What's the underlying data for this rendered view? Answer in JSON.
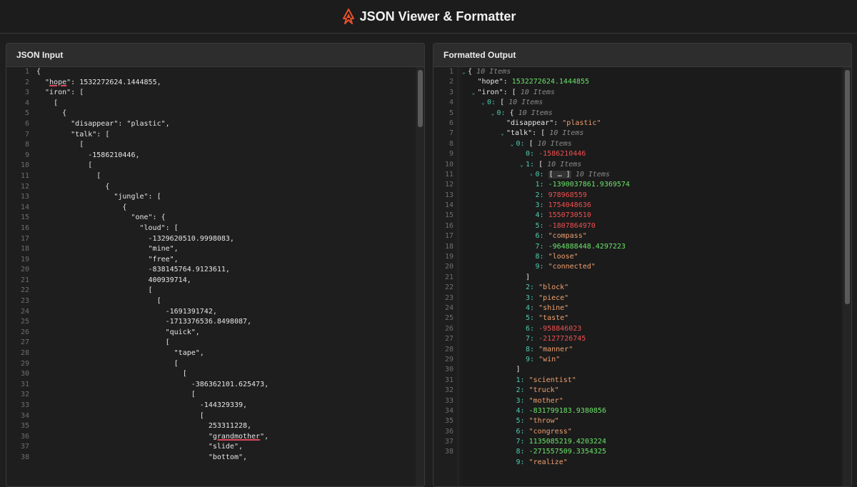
{
  "header": {
    "title": "JSON Viewer & Formatter",
    "logo_icon": "flame-logo-icon"
  },
  "input_panel": {
    "title": "JSON Input",
    "line_numbers": [
      "1",
      "2",
      "3",
      "4",
      "5",
      "6",
      "7",
      "8",
      "9",
      "10",
      "11",
      "12",
      "13",
      "14",
      "15",
      "16",
      "17",
      "18",
      "19",
      "20",
      "21",
      "22",
      "23",
      "24",
      "25",
      "26",
      "27",
      "28",
      "29",
      "30",
      "31",
      "32",
      "33",
      "34",
      "35",
      "36",
      "37",
      "38"
    ],
    "lines": [
      "{",
      "  \"hope\": 1532272624.1444855,",
      "  \"iron\": [",
      "    [",
      "      {",
      "        \"disappear\": \"plastic\",",
      "        \"talk\": [",
      "          [",
      "            -1586210446,",
      "            [",
      "              [",
      "                {",
      "                  \"jungle\": [",
      "                    {",
      "                      \"one\": {",
      "                        \"loud\": [",
      "                          -1329620510.9998083,",
      "                          \"mine\",",
      "                          \"free\",",
      "                          -838145764.9123611,",
      "                          400939714,",
      "                          [",
      "                            [",
      "                              -1691391742,",
      "                              -1713376536.8498087,",
      "                              \"quick\",",
      "                              [",
      "                                \"tape\",",
      "                                [",
      "                                  [",
      "                                    -386362101.625473,",
      "                                    [",
      "                                      -144329339,",
      "                                      [",
      "                                        253311228,",
      "                                        \"grandmother\",",
      "                                        \"slide\",",
      "                                        \"bottom\","
    ]
  },
  "output_panel": {
    "title": "Formatted Output",
    "line_numbers": [
      "1",
      "2",
      "3",
      "4",
      "5",
      "6",
      "7",
      "8",
      "9",
      "10",
      "11",
      "12",
      "13",
      "14",
      "15",
      "16",
      "17",
      "18",
      "19",
      "20",
      "21",
      "22",
      "23",
      "24",
      "25",
      "26",
      "27",
      "28",
      "29",
      "30",
      "31",
      "32",
      "33",
      "34",
      "35",
      "36",
      "37",
      "38"
    ],
    "tree": [
      {
        "indent": 0,
        "arrow": "down",
        "key": "",
        "open": "{",
        "count": "10 Items"
      },
      {
        "indent": 1,
        "key": "\"hope\"",
        "value": "1532272624.1444855",
        "vtype": "num"
      },
      {
        "indent": 1,
        "arrow": "down",
        "key": "\"iron\"",
        "open": "[",
        "count": "10 Items"
      },
      {
        "indent": 2,
        "arrow": "down",
        "idx": "0",
        "open": "[",
        "count": "10 Items"
      },
      {
        "indent": 3,
        "arrow": "down",
        "idx": "0",
        "open": "{",
        "count": "10 Items"
      },
      {
        "indent": 4,
        "key": "\"disappear\"",
        "value": "\"plastic\"",
        "vtype": "str"
      },
      {
        "indent": 4,
        "arrow": "down",
        "key": "\"talk\"",
        "open": "[",
        "count": "10 Items"
      },
      {
        "indent": 5,
        "arrow": "down",
        "idx": "0",
        "open": "[",
        "count": "10 Items"
      },
      {
        "indent": 6,
        "idx": "0",
        "value": "-1586210446",
        "vtype": "neg"
      },
      {
        "indent": 6,
        "arrow": "down",
        "idx": "1",
        "open": "[",
        "count": "10 Items"
      },
      {
        "indent": 7,
        "arrow": "right",
        "idx": "0",
        "collapsed": "[ … ]",
        "count": "10 Items"
      },
      {
        "indent": 7,
        "idx": "1",
        "value": "-1390037861.9369574",
        "vtype": "num"
      },
      {
        "indent": 7,
        "idx": "2",
        "value": "978968559",
        "vtype": "neg"
      },
      {
        "indent": 7,
        "idx": "3",
        "value": "1754048636",
        "vtype": "neg"
      },
      {
        "indent": 7,
        "idx": "4",
        "value": "1550730510",
        "vtype": "neg"
      },
      {
        "indent": 7,
        "idx": "5",
        "value": "-1807864970",
        "vtype": "neg"
      },
      {
        "indent": 7,
        "idx": "6",
        "value": "\"compass\"",
        "vtype": "str"
      },
      {
        "indent": 7,
        "idx": "7",
        "value": "-964888448.4297223",
        "vtype": "num"
      },
      {
        "indent": 7,
        "idx": "8",
        "value": "\"loose\"",
        "vtype": "str"
      },
      {
        "indent": 7,
        "idx": "9",
        "value": "\"connected\"",
        "vtype": "str"
      },
      {
        "indent": 6,
        "close": "]"
      },
      {
        "indent": 6,
        "idx": "2",
        "value": "\"block\"",
        "vtype": "str"
      },
      {
        "indent": 6,
        "idx": "3",
        "value": "\"piece\"",
        "vtype": "str"
      },
      {
        "indent": 6,
        "idx": "4",
        "value": "\"shine\"",
        "vtype": "str"
      },
      {
        "indent": 6,
        "idx": "5",
        "value": "\"taste\"",
        "vtype": "str"
      },
      {
        "indent": 6,
        "idx": "6",
        "value": "-958846023",
        "vtype": "neg"
      },
      {
        "indent": 6,
        "idx": "7",
        "value": "-2127726745",
        "vtype": "neg"
      },
      {
        "indent": 6,
        "idx": "8",
        "value": "\"manner\"",
        "vtype": "str"
      },
      {
        "indent": 6,
        "idx": "9",
        "value": "\"win\"",
        "vtype": "str"
      },
      {
        "indent": 5,
        "close": "]"
      },
      {
        "indent": 5,
        "idx": "1",
        "value": "\"scientist\"",
        "vtype": "str"
      },
      {
        "indent": 5,
        "idx": "2",
        "value": "\"truck\"",
        "vtype": "str"
      },
      {
        "indent": 5,
        "idx": "3",
        "value": "\"mother\"",
        "vtype": "str"
      },
      {
        "indent": 5,
        "idx": "4",
        "value": "-831799183.9380856",
        "vtype": "num"
      },
      {
        "indent": 5,
        "idx": "5",
        "value": "\"throw\"",
        "vtype": "str"
      },
      {
        "indent": 5,
        "idx": "6",
        "value": "\"congress\"",
        "vtype": "str"
      },
      {
        "indent": 5,
        "idx": "7",
        "value": "1135085219.4203224",
        "vtype": "num"
      },
      {
        "indent": 5,
        "idx": "8",
        "value": "-271557509.3354325",
        "vtype": "num"
      },
      {
        "indent": 5,
        "idx": "9",
        "value": "\"realize\"",
        "vtype": "str"
      }
    ]
  }
}
